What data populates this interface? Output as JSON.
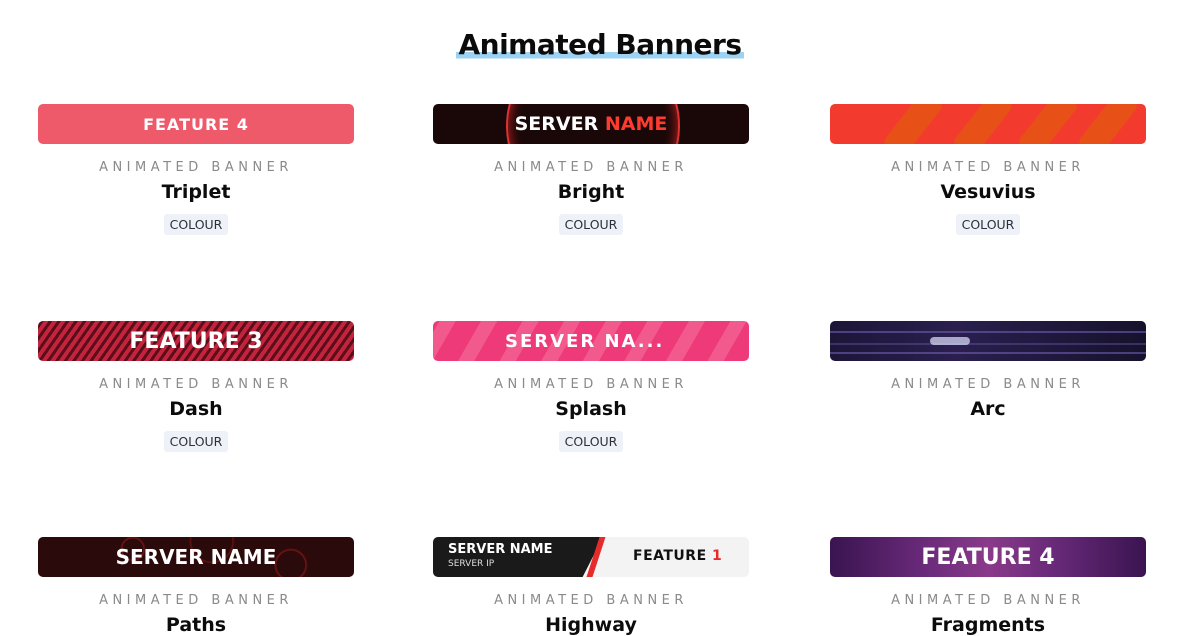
{
  "page": {
    "title": "Animated Banners"
  },
  "cards": [
    {
      "banner_text": "FEATURE 4",
      "subtitle": "ANIMATED BANNER",
      "name": "Triplet",
      "tag": "COLOUR"
    },
    {
      "banner_text": "SERVER",
      "banner_accent": "NAME",
      "subtitle": "ANIMATED BANNER",
      "name": "Bright",
      "tag": "COLOUR"
    },
    {
      "banner_text": "",
      "subtitle": "ANIMATED BANNER",
      "name": "Vesuvius",
      "tag": "COLOUR"
    },
    {
      "banner_text": "FEATURE 3",
      "subtitle": "ANIMATED BANNER",
      "name": "Dash",
      "tag": "COLOUR"
    },
    {
      "banner_text": "SERVER NA...",
      "subtitle": "ANIMATED BANNER",
      "name": "Splash",
      "tag": "COLOUR"
    },
    {
      "banner_text": "",
      "subtitle": "ANIMATED BANNER",
      "name": "Arc"
    },
    {
      "banner_text": "SERVER NAME",
      "subtitle": "ANIMATED BANNER",
      "name": "Paths"
    },
    {
      "banner_text": "SERVER NAME",
      "banner_sub": "SERVER IP",
      "banner_right": "FEATURE",
      "banner_right_num": "1",
      "subtitle": "ANIMATED BANNER",
      "name": "Highway"
    },
    {
      "banner_text": "FEATURE 4",
      "subtitle": "ANIMATED BANNER",
      "name": "Fragments"
    }
  ],
  "colors": {
    "title_underline": "#9cd3f3",
    "tag_bg": "#eef2f8",
    "accent_red": "#e52b2b"
  }
}
